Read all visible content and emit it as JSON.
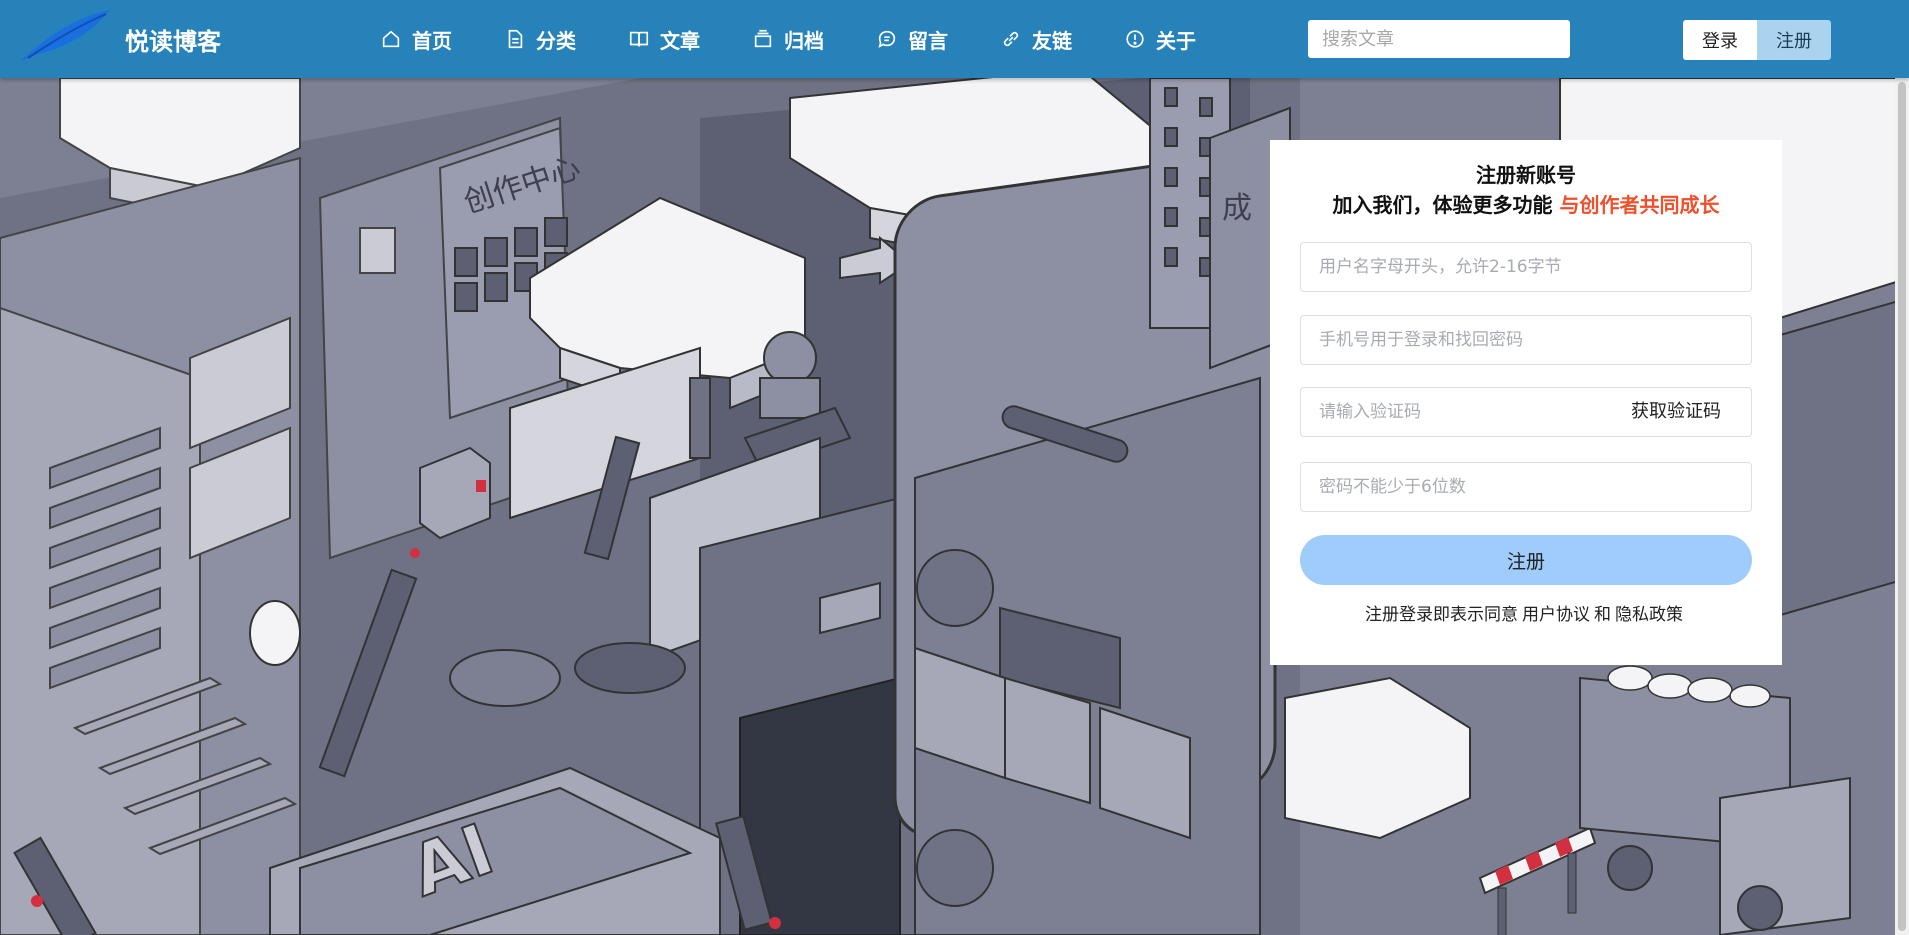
{
  "header": {
    "site_name": "悦读博客",
    "nav": [
      {
        "label": "首页",
        "icon": "home-icon"
      },
      {
        "label": "分类",
        "icon": "document-icon"
      },
      {
        "label": "文章",
        "icon": "book-icon"
      },
      {
        "label": "归档",
        "icon": "archive-icon"
      },
      {
        "label": "留言",
        "icon": "message-icon"
      },
      {
        "label": "友链",
        "icon": "link-icon"
      },
      {
        "label": "关于",
        "icon": "info-icon"
      }
    ],
    "search_placeholder": "搜索文章",
    "login_label": "登录",
    "register_label": "注册"
  },
  "background": {
    "sign_text": "创作中心",
    "ai_text": "AI",
    "building_text": "成"
  },
  "register_card": {
    "title": "注册新账号",
    "subtitle_main": "加入我们，体验更多功能",
    "subtitle_accent": "与创作者共同成长",
    "username_placeholder": "用户名字母开头，允许2-16字节",
    "phone_placeholder": "手机号用于登录和找回密码",
    "code_placeholder": "请输入验证码",
    "get_code_label": "获取验证码",
    "password_placeholder": "密码不能少于6位数",
    "submit_label": "注册",
    "agree_prefix": "注册登录即表示同意",
    "user_agreement": "用户协议",
    "and_text": "和",
    "privacy_policy": "隐私政策"
  },
  "colors": {
    "header_bg": "#2682b9",
    "accent": "#f24e2a",
    "submit_bg": "#9fccfb",
    "register_btn_bg": "#a9d3ee"
  }
}
